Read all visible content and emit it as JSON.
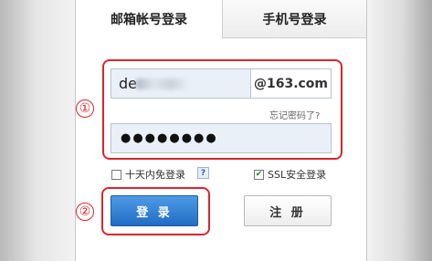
{
  "tabs": {
    "mail_login": "邮箱帐号登录",
    "phone_login": "手机号登录"
  },
  "markers": {
    "one": "①",
    "two": "②"
  },
  "form": {
    "username_value": "de",
    "domain_suffix": "@163.com",
    "forgot_password": "忘记密码了?",
    "password_value": "●●●●●●●●"
  },
  "options": {
    "remember_label": "十天内免登录",
    "remember_checked": false,
    "help_symbol": "?",
    "ssl_label": "SSL安全登录",
    "ssl_checked": true,
    "ssl_check_mark": "✔"
  },
  "buttons": {
    "login": "登 录",
    "register": "注 册"
  },
  "colors": {
    "annotation_red": "#d8262e",
    "login_blue": "#1f6cc4"
  }
}
